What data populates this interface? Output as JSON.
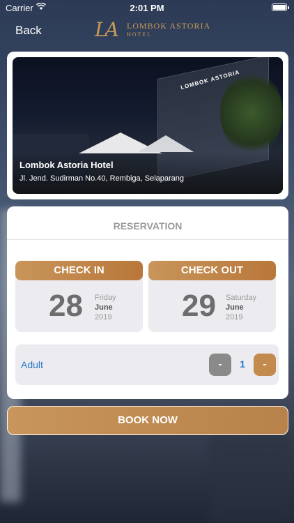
{
  "status_bar": {
    "carrier": "Carrier",
    "time": "2:01 PM"
  },
  "navbar": {
    "back_label": "Back",
    "logo_monogram": "LA",
    "logo_name": "LOMBOK ASTORIA",
    "logo_sub": "HOTEL"
  },
  "hotel": {
    "name": "Lombok Astoria Hotel",
    "address": "Jl. Jend. Sudirman No.40, Rembiga, Selaparang",
    "sign_text": "LOMBOK ASTORIA"
  },
  "reservation": {
    "title": "RESERVATION",
    "check_in": {
      "label": "CHECK IN",
      "day": "28",
      "weekday": "Friday",
      "month": "June",
      "year": "2019"
    },
    "check_out": {
      "label": "CHECK OUT",
      "day": "29",
      "weekday": "Saturday",
      "month": "June",
      "year": "2019"
    },
    "guests": {
      "label": "Adult",
      "count": "1",
      "minus_label": "-",
      "plus_label": "-"
    }
  },
  "book_label": "BOOK NOW",
  "colors": {
    "accent": "#c28a4d",
    "link": "#2a78c8"
  }
}
